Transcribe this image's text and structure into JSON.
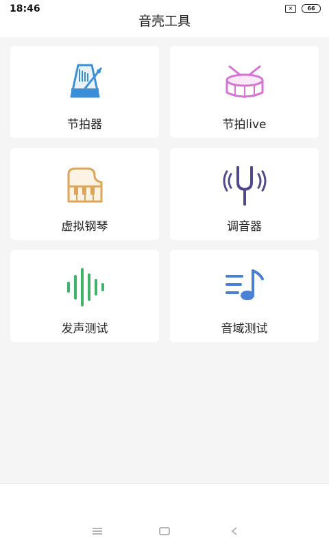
{
  "status_bar": {
    "time": "18:46",
    "sim_label": "✕",
    "battery": "66"
  },
  "header": {
    "title": "音壳工具"
  },
  "tools": [
    {
      "label": "节拍器",
      "icon": "metronome-icon",
      "color": "#3b8fd9"
    },
    {
      "label": "节拍live",
      "icon": "drum-icon",
      "color": "#d673d4"
    },
    {
      "label": "虚拟钢琴",
      "icon": "piano-icon",
      "color": "#dca557"
    },
    {
      "label": "调音器",
      "icon": "tuning-fork-icon",
      "color": "#4f4a8c"
    },
    {
      "label": "发声测试",
      "icon": "sound-wave-icon",
      "color": "#3fb36a"
    },
    {
      "label": "音域测试",
      "icon": "music-note-icon",
      "color": "#4a7fd6"
    }
  ]
}
